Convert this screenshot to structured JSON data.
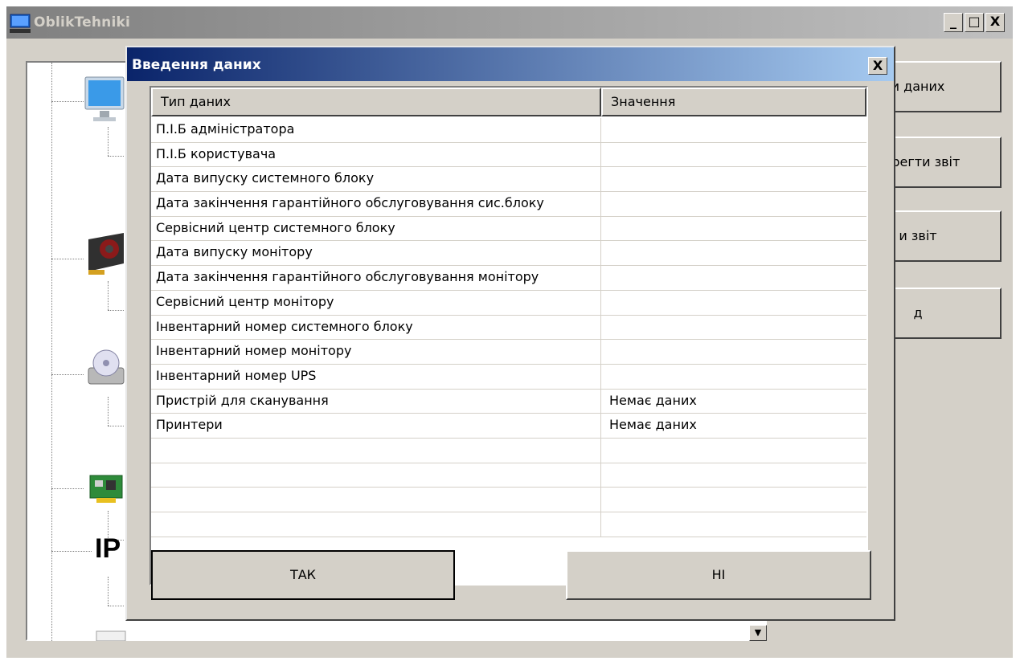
{
  "window": {
    "title": "OblikTehniki",
    "controls": {
      "minimize": "_",
      "maximize": "□",
      "close": "X"
    }
  },
  "side_buttons": [
    {
      "label": "и даних"
    },
    {
      "label": "берегти звіт"
    },
    {
      "label": "и звіт"
    },
    {
      "label": "д"
    }
  ],
  "tree": {
    "icons": [
      "monitor-icon",
      "graphics-card-icon",
      "drive-icon",
      "network-card-icon",
      "ip-icon",
      "generic-device-icon"
    ],
    "ip_label": "IP"
  },
  "dialog": {
    "title": "Введення даних",
    "close": "X",
    "columns": [
      "Тип даних",
      "Значення"
    ],
    "rows": [
      {
        "type": "П.І.Б адміністратора",
        "value": ""
      },
      {
        "type": "П.І.Б користувача",
        "value": ""
      },
      {
        "type": "Дата випуску системного блоку",
        "value": ""
      },
      {
        "type": "Дата закінчення гарантійного обслуговування сис.блоку",
        "value": ""
      },
      {
        "type": "Сервісний центр системного блоку",
        "value": ""
      },
      {
        "type": "Дата випуску монітору",
        "value": ""
      },
      {
        "type": "Дата закінчення гарантійного обслуговування монітору",
        "value": ""
      },
      {
        "type": "Сервісний центр монітору",
        "value": ""
      },
      {
        "type": "Інвентарний номер системного блоку",
        "value": ""
      },
      {
        "type": "Інвентарний номер монітору",
        "value": ""
      },
      {
        "type": "Інвентарний номер UPS",
        "value": ""
      },
      {
        "type": "Пристрій для сканування",
        "value": "Немає даних"
      },
      {
        "type": "Принтери",
        "value": "Немає даних"
      },
      {
        "type": "",
        "value": ""
      },
      {
        "type": "",
        "value": ""
      },
      {
        "type": "",
        "value": ""
      },
      {
        "type": "",
        "value": ""
      }
    ],
    "ok_label": "ТАК",
    "cancel_label": "НІ"
  }
}
